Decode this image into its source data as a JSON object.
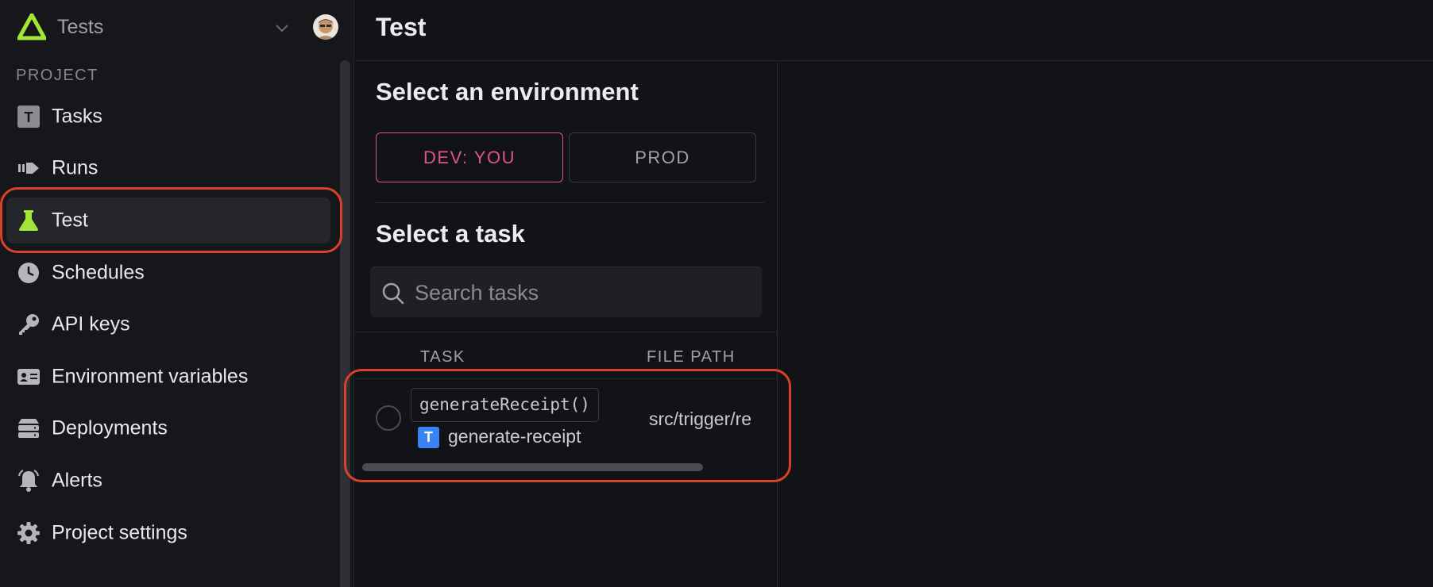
{
  "sidebar": {
    "project_name": "Tests",
    "section_label": "PROJECT",
    "items": [
      {
        "label": "Tasks",
        "icon": "tasks-icon"
      },
      {
        "label": "Runs",
        "icon": "runs-icon"
      },
      {
        "label": "Test",
        "icon": "flask-icon",
        "active": true
      },
      {
        "label": "Schedules",
        "icon": "clock-icon"
      },
      {
        "label": "API keys",
        "icon": "key-icon"
      },
      {
        "label": "Environment variables",
        "icon": "id-card-icon"
      },
      {
        "label": "Deployments",
        "icon": "server-stack-icon"
      },
      {
        "label": "Alerts",
        "icon": "bell-icon"
      },
      {
        "label": "Project settings",
        "icon": "gear-icon"
      }
    ]
  },
  "header": {
    "title": "Test"
  },
  "environment": {
    "heading": "Select an environment",
    "options": [
      "DEV: YOU",
      "PROD"
    ],
    "selected": "DEV: YOU"
  },
  "task_select": {
    "heading": "Select a task",
    "search_placeholder": "Search tasks",
    "columns": [
      "TASK",
      "FILE PATH"
    ],
    "rows": [
      {
        "function": "generateReceipt()",
        "badge": "T",
        "id": "generate-receipt",
        "file_path": "src/trigger/re"
      }
    ]
  },
  "colors": {
    "background": "#121317",
    "sidebar": "#16171b",
    "dev_accent": "#e0538f",
    "logo_accent": "#a3e635",
    "task_badge": "#3b82f6",
    "annotation": "#d9412b"
  }
}
